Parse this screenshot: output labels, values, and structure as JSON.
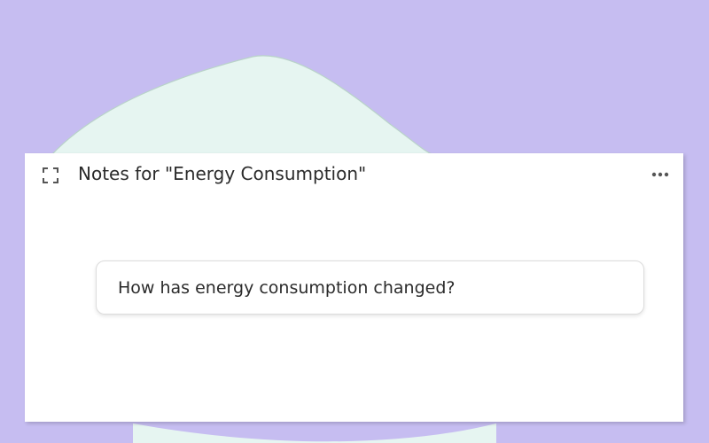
{
  "colors": {
    "background": "#c6bdf1",
    "blob_fill": "#e6f5f1",
    "panel": "#ffffff",
    "text": "#2b2b2b"
  },
  "panel": {
    "title": "Notes for \"Energy Consumption\"",
    "expand_icon": "expand-icon",
    "more_icon": "more-options-icon"
  },
  "note": {
    "text": "How has energy consumption changed?"
  }
}
